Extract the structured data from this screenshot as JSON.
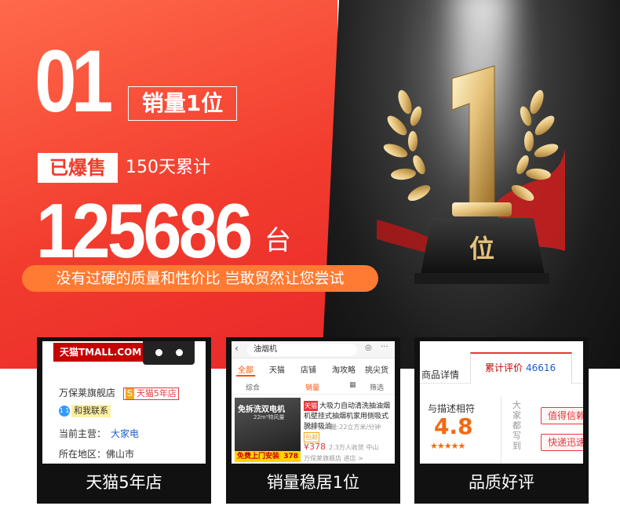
{
  "hero": {
    "rank_number": "01",
    "rank_label": "销量1位",
    "sold_tag": "已爆售",
    "period": "150天累计",
    "sales_count": "125686",
    "sales_unit": "台",
    "slogan": "没有过硬的质量和性价比 岂敢贸然让您尝试",
    "trophy_number": "1",
    "trophy_label": "位"
  },
  "cards": [
    {
      "caption": "天猫5年店",
      "tmall_logo": "天猫TMALL.COM",
      "store_name": "万保莱旗舰店",
      "store_years_badge": "天猫5年店",
      "store_badge_icon": "S",
      "contact_label": "和我联系",
      "contact_icon_text": "1 1",
      "main_business_label": "当前主营：",
      "main_business_value": "大家电",
      "location_label": "所在地区：",
      "location_value": "佛山市"
    },
    {
      "caption": "销量稳居1位",
      "search_query": "油烟机",
      "tabs": [
        "全部",
        "天猫",
        "店铺",
        "淘攻略",
        "挑尖货"
      ],
      "sort_options": [
        "综合",
        "销量",
        "筛选"
      ],
      "product_image_title": "免拆洗双电机",
      "product_image_subtitle": "22m³特风量",
      "product_image_banner": "免费上门安装",
      "product_image_price": "378",
      "tmall_tag": "天猫",
      "product_title": "大吸力自动清洗抽油烟机壁挂式抽烟机家用侧吸式脱排吸油",
      "product_meta": "侧吸  排风量:22立方米/分钟",
      "product_badge": "包邮",
      "price": "¥378",
      "sales_meta": "2.3万人收货  中山",
      "store_meta": "万保莱旗舰店  进店 >"
    },
    {
      "caption": "品质好评",
      "tab_details": "商品详情",
      "tab_reviews": "累计评价",
      "review_count": "46616",
      "score_label": "与描述相符",
      "score": "4.8",
      "stars": "★★★★★",
      "impression_label": "大家都写到",
      "chips": [
        "值得信赖",
        "快递迅速"
      ]
    }
  ]
}
